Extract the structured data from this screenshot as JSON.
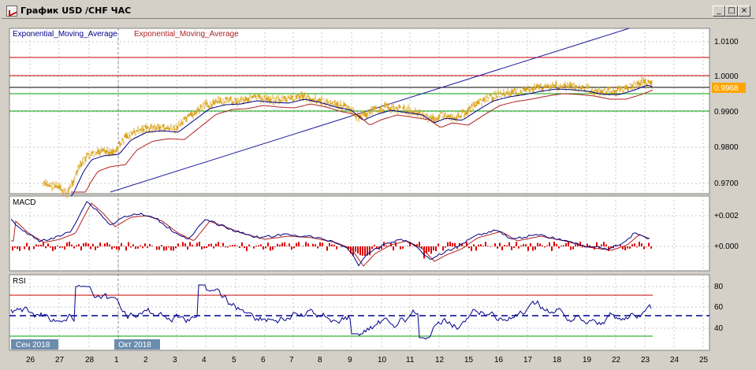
{
  "window": {
    "title": "График USD /CHF  ЧАС",
    "min_label": "_",
    "max_label": "□",
    "close_label": "×"
  },
  "main_panel": {
    "legend": [
      {
        "label": "Exponential_Moving_Average",
        "color": "#00008b"
      },
      {
        "label": "Exponential_Moving_Average",
        "color": "#b22222"
      }
    ],
    "y_ticks": [
      "1.0100",
      "1.0000",
      "0.9900",
      "0.9800",
      "0.9700"
    ],
    "current_price": "0.9968",
    "current_price_bg": "#ffa500"
  },
  "macd_panel": {
    "label": "MACD",
    "y_ticks": [
      "+0.002",
      "+0.000"
    ]
  },
  "rsi_panel": {
    "label": "RSI",
    "y_ticks": [
      "80",
      "60",
      "40"
    ]
  },
  "time_axis": {
    "month_labels": [
      "Сен 2018",
      "Окт 2018"
    ],
    "day_labels": [
      "26",
      "27",
      "28",
      "1",
      "2",
      "3",
      "4",
      "5",
      "6",
      "7",
      "8",
      "9",
      "10",
      "11",
      "12",
      "15",
      "16",
      "17",
      "18",
      "19",
      "22",
      "23",
      "24",
      "25",
      "26",
      "27"
    ]
  },
  "colors": {
    "price": "#daa520",
    "ema_fast": "#00008b",
    "ema_slow": "#b22222",
    "trendline": "#1c1c9c",
    "resistance": "#cc0000",
    "support": "#00a000",
    "macd_hist": "#dd0000",
    "rsi_line": "#00008b",
    "rsi_overbought": "#c000c0"
  }
}
